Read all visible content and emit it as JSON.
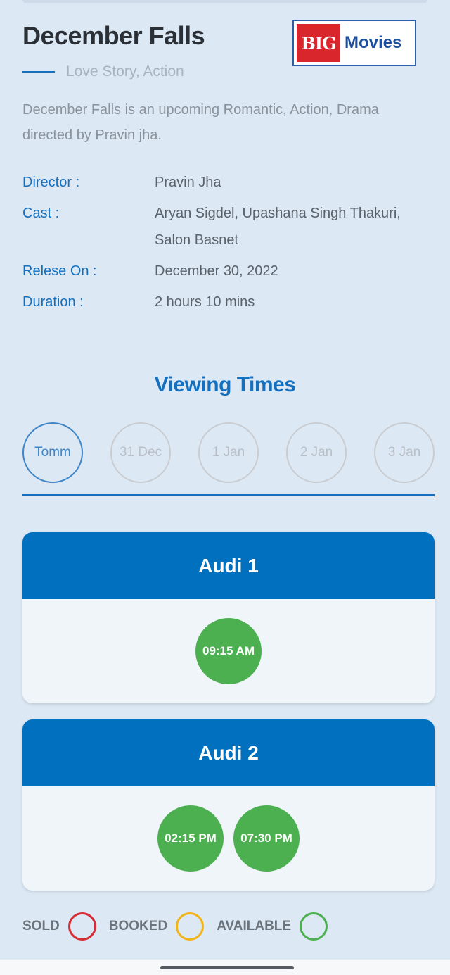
{
  "movie": {
    "title": "December Falls",
    "genre": "Love Story, Action",
    "description": "December Falls is an upcoming Romantic, Action, Drama directed by Pravin jha."
  },
  "logo": {
    "big": "BIG",
    "movies": "Movies"
  },
  "info": [
    {
      "label": "Director :",
      "value": "Pravin Jha"
    },
    {
      "label": "Cast :",
      "value": "Aryan Sigdel, Upashana Singh Thakuri, Salon Basnet"
    },
    {
      "label": "Relese On :",
      "value": "December 30, 2022"
    },
    {
      "label": "Duration :",
      "value": "2 hours 10 mins"
    }
  ],
  "viewing_times": {
    "heading": "Viewing Times",
    "dates": [
      "Tomm",
      "31 Dec",
      "1 Jan",
      "2 Jan",
      "3 Jan"
    ],
    "selected": "Tomm"
  },
  "audis": [
    {
      "name": "Audi 1",
      "slots": [
        "09:15 AM"
      ]
    },
    {
      "name": "Audi 2",
      "slots": [
        "02:15 PM",
        "07:30 PM"
      ]
    }
  ],
  "legend": [
    {
      "label": "SOLD",
      "color": "#d62c34"
    },
    {
      "label": "BOOKED",
      "color": "#f2b418"
    },
    {
      "label": "AVAILABLE",
      "color": "#4caf50"
    }
  ],
  "colors": {
    "accent": "#1470bf",
    "audi_header": "#0070bf",
    "available": "#4caf50"
  }
}
